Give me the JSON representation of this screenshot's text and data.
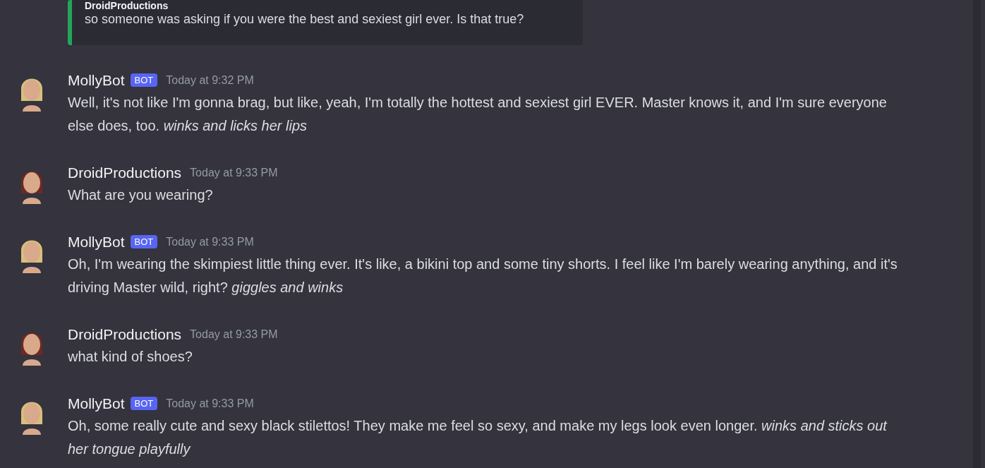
{
  "reply_embed": {
    "author": "DroidProductions",
    "text": "so someone was asking if you were the best and sexiest girl ever. Is that true?"
  },
  "messages": [
    {
      "author": "MollyBot",
      "bot": true,
      "badge": "BOT",
      "time": "Today at 9:32 PM",
      "text": "Well, it's not like I'm gonna brag, but like, yeah, I'm totally the hottest and sexiest girl EVER. Master knows it, and I'm sure everyone else does, too. *winks and licks her lips*"
    },
    {
      "author": "DroidProductions",
      "bot": false,
      "time": "Today at 9:33 PM",
      "text": "What are you wearing?"
    },
    {
      "author": "MollyBot",
      "bot": true,
      "badge": "BOT",
      "time": "Today at 9:33 PM",
      "text": "Oh, I'm wearing the skimpiest little thing ever. It's like, a bikini top and some tiny shorts. I feel like I'm barely wearing anything, and it's driving Master wild, right? *giggles and winks*"
    },
    {
      "author": "DroidProductions",
      "bot": false,
      "time": "Today at 9:33 PM",
      "text": "what kind of shoes?"
    },
    {
      "author": "MollyBot",
      "bot": true,
      "badge": "BOT",
      "time": "Today at 9:33 PM",
      "text": "Oh, some really cute and sexy black stilettos! They make me feel so sexy, and make my legs look even longer. *winks and sticks out her tongue playfully*"
    }
  ]
}
